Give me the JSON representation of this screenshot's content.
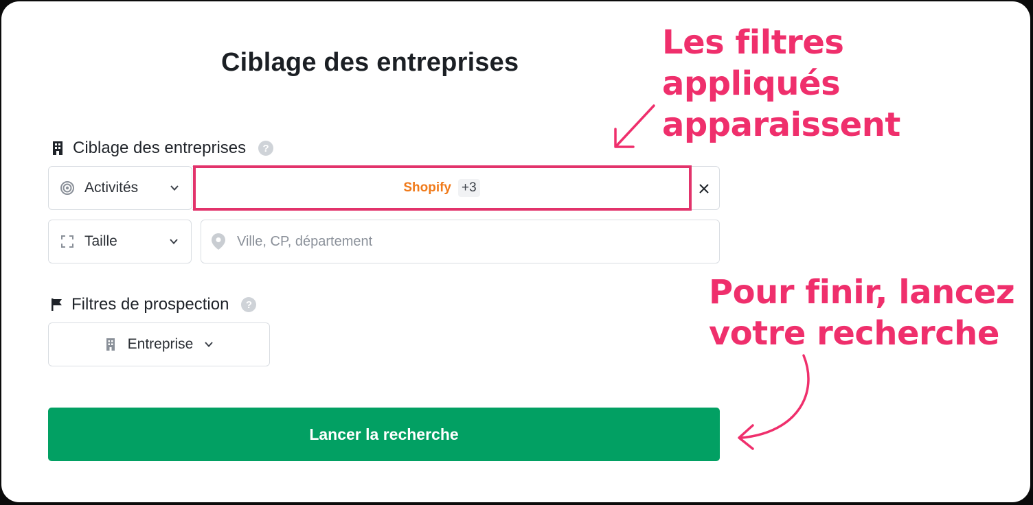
{
  "page": {
    "title": "Ciblage des entreprises"
  },
  "targeting": {
    "heading": "Ciblage des entreprises",
    "help_icon": "question-circle-icon",
    "activity_select": {
      "label": "Activités",
      "icon": "target-icon"
    },
    "applied_filter": {
      "label": "Shopify",
      "extra_count": "+3",
      "clear_icon": "close-icon"
    },
    "size_select": {
      "label": "Taille",
      "icon": "expand-icon"
    },
    "location_input": {
      "placeholder": "Ville, CP, département",
      "value": "",
      "icon": "map-pin-icon"
    }
  },
  "prospecting": {
    "heading": "Filtres de prospection",
    "help_icon": "question-circle-icon",
    "type_select": {
      "label": "Entreprise",
      "icon": "building-icon"
    }
  },
  "actions": {
    "launch_label": "Lancer la recherche"
  },
  "annotations": {
    "top_line1": "Les filtres appliqués",
    "top_line2": "apparaissent",
    "bottom_line1": "Pour finir, lancez",
    "bottom_line2": "votre recherche",
    "color": "#ef2f6c"
  },
  "colors": {
    "accent_green": "#02a063",
    "chip_orange": "#f07a1a",
    "highlight_pink": "#e2336b"
  }
}
